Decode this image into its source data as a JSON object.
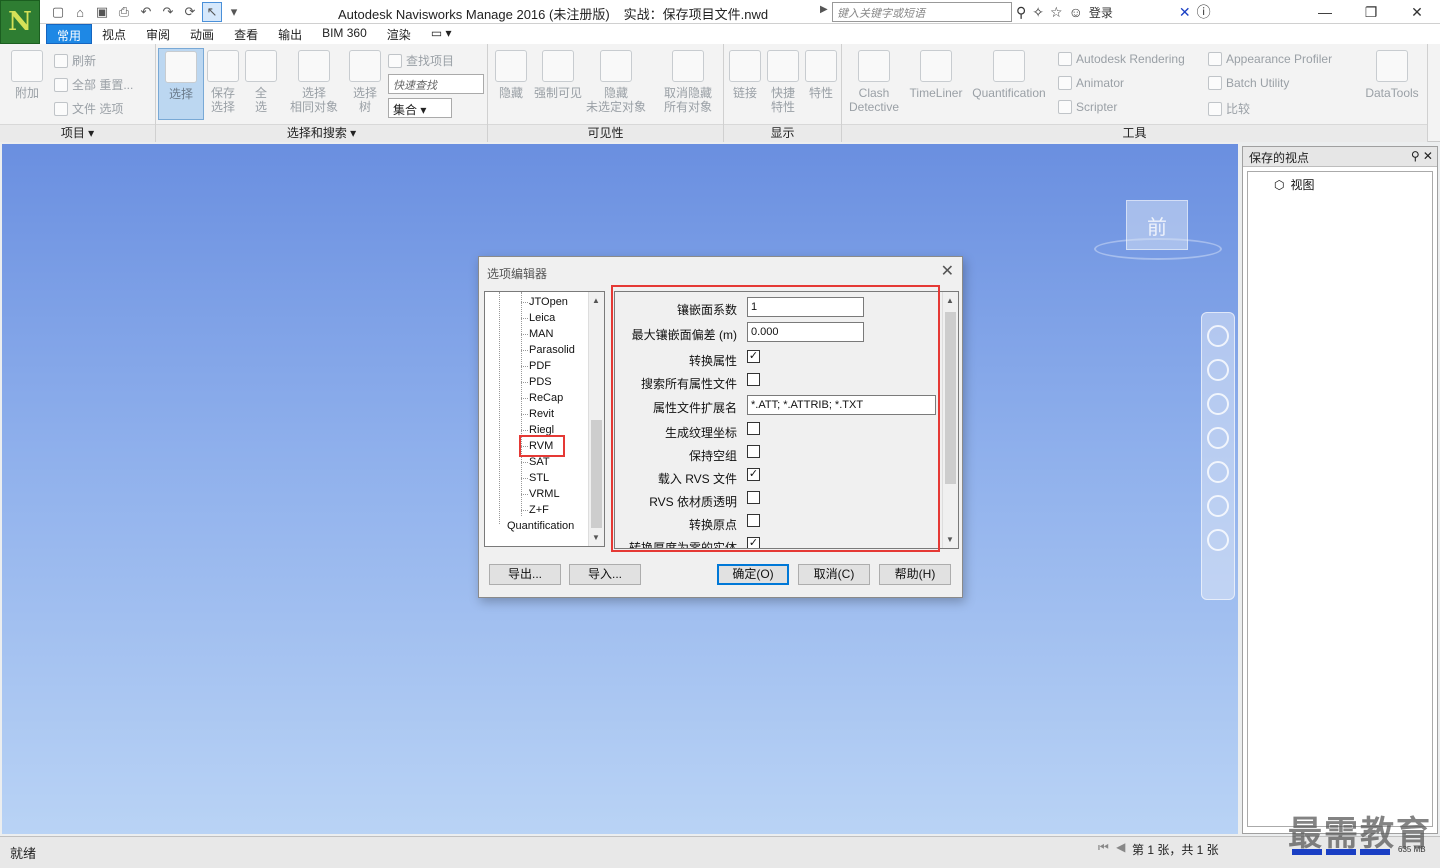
{
  "titlebar": {
    "app_name": "Autodesk Navisworks Manage 2016 (未注册版)",
    "document": "实战：保存项目文件.nwd",
    "search_placeholder": "键入关键字或短语",
    "login": "登录",
    "logo_letter": "N"
  },
  "tabs": [
    "常用",
    "视点",
    "审阅",
    "动画",
    "查看",
    "输出",
    "BIM 360",
    "渲染"
  ],
  "ribbon": {
    "project": {
      "title": "项目",
      "append": "附加",
      "refresh": "刷新",
      "reset_all": "全部 重置...",
      "file_options": "文件 选项"
    },
    "select_search": {
      "title": "选择和搜索",
      "select": "选择",
      "save_selection": "保存\n选择",
      "select_all": "全\n选",
      "select_same": "选择\n相同对象",
      "select_tree": "选择\n树",
      "find_items": "查找项目",
      "quick_find": "快速查找",
      "sets": "集合"
    },
    "visibility": {
      "title": "可见性",
      "hide": "隐藏",
      "require": "强制可见",
      "hide_unselected": "隐藏\n未选定对象",
      "unhide_all": "取消隐藏\n所有对象"
    },
    "display": {
      "title": "显示",
      "links": "链接",
      "quick_props": "快捷\n特性",
      "properties": "特性"
    },
    "tools": {
      "title": "工具",
      "clash": "Clash\nDetective",
      "timeliner": "TimeLiner",
      "quantification": "Quantification",
      "rendering": "Autodesk Rendering",
      "animator": "Animator",
      "scripter": "Scripter",
      "appearance": "Appearance Profiler",
      "batch": "Batch Utility",
      "compare": "比较",
      "datatools": "DataTools"
    }
  },
  "viewcube": {
    "face": "前"
  },
  "saved_viewpoints": {
    "title": "保存的视点",
    "items": [
      "视图"
    ]
  },
  "statusbar": {
    "status": "就绪",
    "page": "第 1 张，共 1 张",
    "memory": "635 MB"
  },
  "watermark": "最需教育",
  "dialog": {
    "title": "选项编辑器",
    "tree_items": [
      "JTOpen",
      "Leica",
      "MAN",
      "Parasolid",
      "PDF",
      "PDS",
      "ReCap",
      "Revit",
      "Riegl",
      "RVM",
      "SAT",
      "STL",
      "VRML",
      "Z+F"
    ],
    "tree_root_item": "Quantification",
    "properties": [
      {
        "label": "镶嵌面系数",
        "type": "text",
        "value": "1"
      },
      {
        "label": "最大镶嵌面偏差 (m)",
        "type": "text",
        "value": "0.000"
      },
      {
        "label": "转换属性",
        "type": "check",
        "value": "✓"
      },
      {
        "label": "搜索所有属性文件",
        "type": "check",
        "value": ""
      },
      {
        "label": "属性文件扩展名",
        "type": "text_wide",
        "value": "*.ATT; *.ATTRIB; *.TXT"
      },
      {
        "label": "生成纹理坐标",
        "type": "check",
        "value": ""
      },
      {
        "label": "保持空组",
        "type": "check",
        "value": ""
      },
      {
        "label": "载入 RVS 文件",
        "type": "check",
        "value": "✓"
      },
      {
        "label": "RVS 依材质透明",
        "type": "check",
        "value": ""
      },
      {
        "label": "转换原点",
        "type": "check",
        "value": ""
      },
      {
        "label": "转换厚度为零的实体",
        "type": "check",
        "value": "✓"
      }
    ],
    "buttons": {
      "export": "导出...",
      "import": "导入...",
      "ok": "确定(O)",
      "cancel": "取消(C)",
      "help": "帮助(H)"
    }
  }
}
